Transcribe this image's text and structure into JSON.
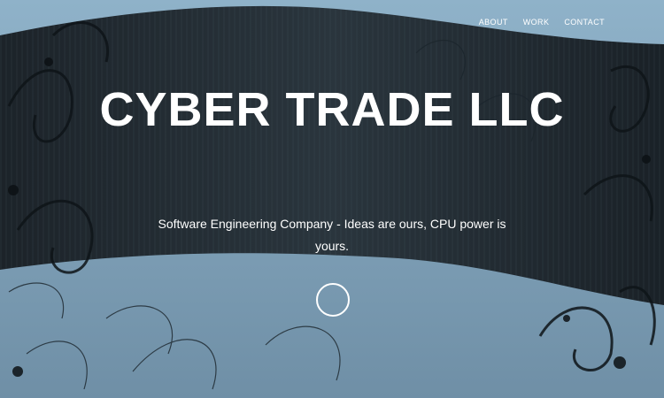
{
  "nav": {
    "items": [
      {
        "label": "ABOUT"
      },
      {
        "label": "WORK"
      },
      {
        "label": "CONTACT"
      }
    ]
  },
  "hero": {
    "title": "CYBER TRADE LLC",
    "subtitle": "Software Engineering Company - Ideas are ours, CPU power is yours."
  },
  "colors": {
    "dark_band": "#1f2a33",
    "light_bg": "#8fb0c7",
    "accent_text": "#ffffff"
  },
  "icons": {
    "scroll": "circle-outline-icon"
  }
}
